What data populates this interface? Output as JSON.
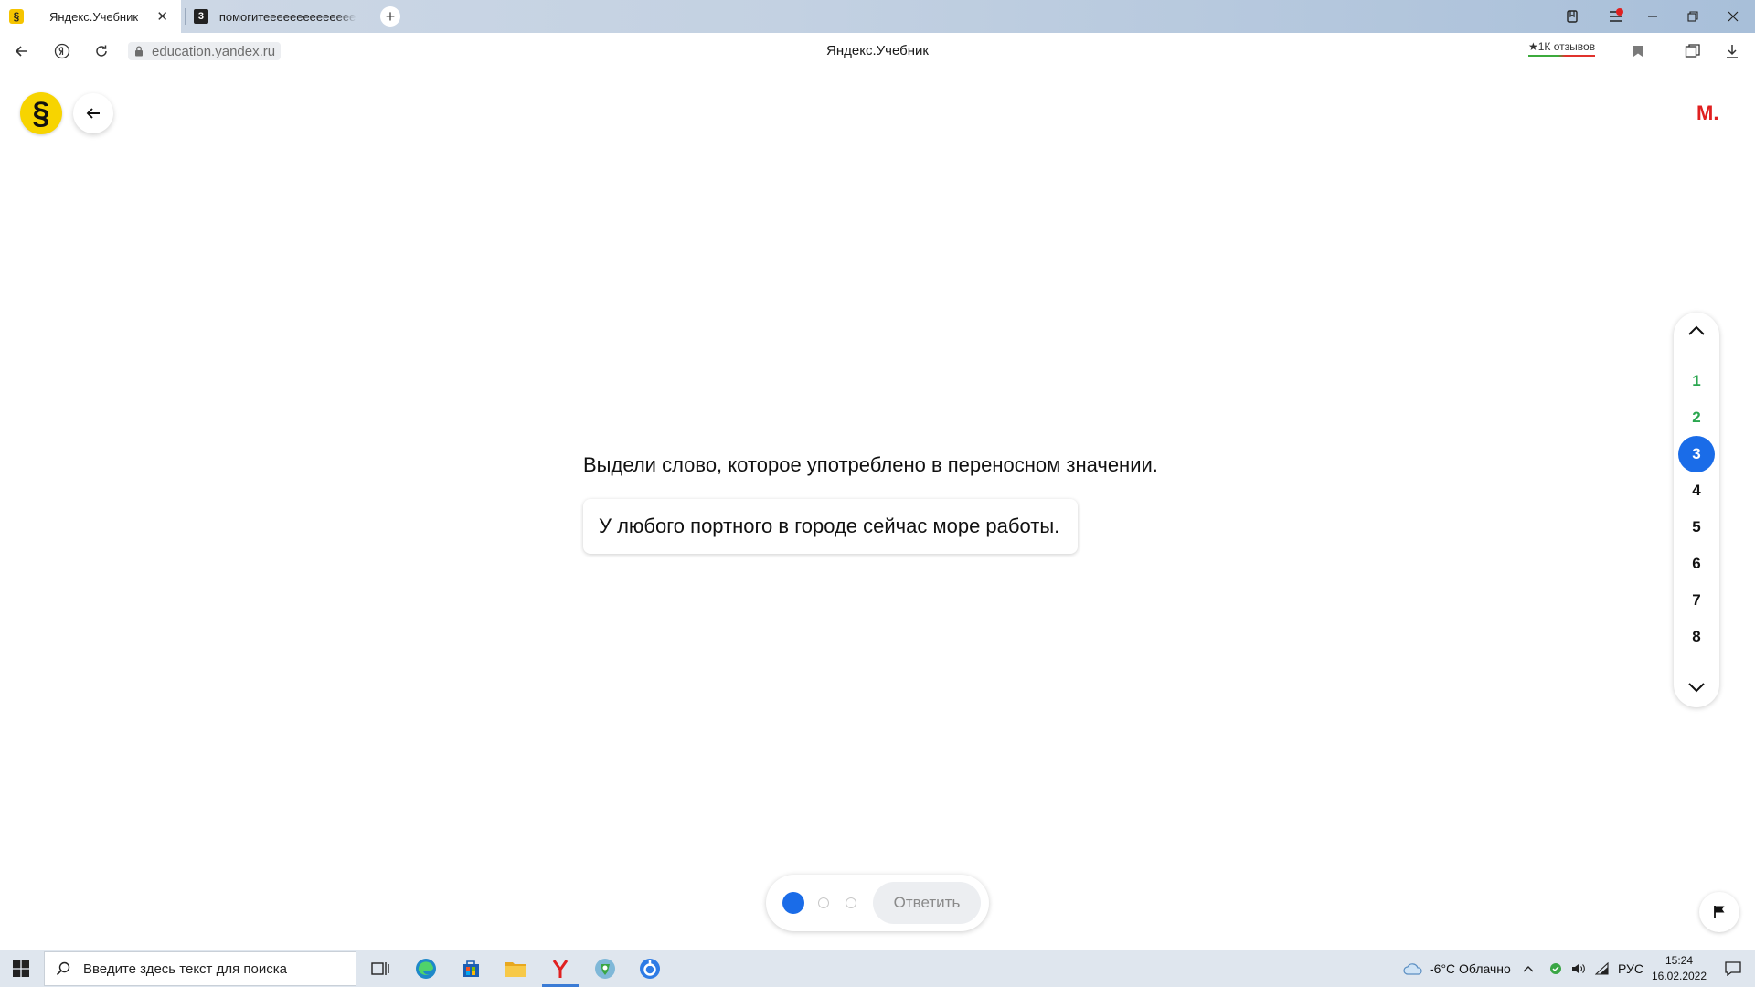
{
  "browser": {
    "tabs": [
      {
        "favicon": "§",
        "title": "Яндекс.Учебник",
        "active": true
      },
      {
        "favicon": "3",
        "title": "помогитееееееееееееее",
        "active": false
      }
    ],
    "new_tab_symbol": "+",
    "url": "education.yandex.ru",
    "page_title": "Яндекс.Учебник",
    "reviews_label": "★1К отзывов"
  },
  "page": {
    "logo_symbol": "§",
    "user_initial": "М.",
    "question": "Выдели слово, которое употреблено в переносном значении.",
    "sentence": "У любого портного в городе сейчас море работы.",
    "task_numbers": [
      {
        "label": "1",
        "state": "done"
      },
      {
        "label": "2",
        "state": "done"
      },
      {
        "label": "3",
        "state": "current"
      },
      {
        "label": "4",
        "state": "pending"
      },
      {
        "label": "5",
        "state": "pending"
      },
      {
        "label": "6",
        "state": "pending"
      },
      {
        "label": "7",
        "state": "pending"
      },
      {
        "label": "8",
        "state": "pending"
      }
    ],
    "answer_button": "Ответить",
    "progress": {
      "total": 3,
      "current": 1
    }
  },
  "taskbar": {
    "search_placeholder": "Введите здесь текст для поиска",
    "weather": "-6°C  Облачно",
    "language": "РУС",
    "time": "15:24",
    "date": "16.02.2022"
  },
  "colors": {
    "accent_blue": "#1a6ce8",
    "done_green": "#2aa64f",
    "logo_yellow": "#f7d400",
    "user_red": "#e02020"
  }
}
